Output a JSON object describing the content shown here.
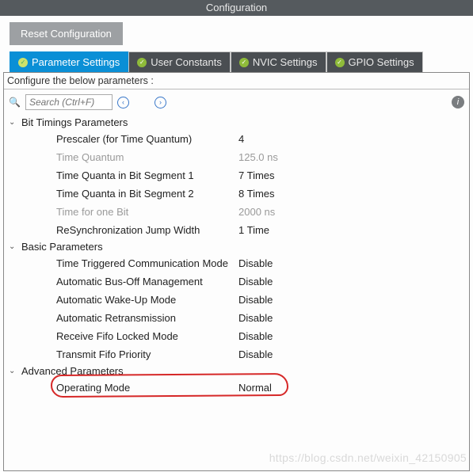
{
  "title": "Configuration",
  "reset_label": "Reset Configuration",
  "tabs": {
    "param": "Parameter Settings",
    "user": "User Constants",
    "nvic": "NVIC Settings",
    "gpio": "GPIO Settings"
  },
  "subheader": "Configure the below parameters :",
  "search_placeholder": "Search (Ctrl+F)",
  "groups": {
    "bit_timings": {
      "label": "Bit Timings Parameters",
      "params": [
        {
          "label": "Prescaler (for Time Quantum)",
          "value": "4",
          "readonly": false
        },
        {
          "label": "Time Quantum",
          "value": "125.0 ns",
          "readonly": true
        },
        {
          "label": "Time Quanta in Bit Segment 1",
          "value": "7 Times",
          "readonly": false
        },
        {
          "label": "Time Quanta in Bit Segment 2",
          "value": "8 Times",
          "readonly": false
        },
        {
          "label": "Time for one Bit",
          "value": "2000 ns",
          "readonly": true
        },
        {
          "label": "ReSynchronization Jump Width",
          "value": "1 Time",
          "readonly": false
        }
      ]
    },
    "basic": {
      "label": "Basic Parameters",
      "params": [
        {
          "label": "Time Triggered Communication Mode",
          "value": "Disable",
          "readonly": false
        },
        {
          "label": "Automatic Bus-Off Management",
          "value": "Disable",
          "readonly": false
        },
        {
          "label": "Automatic Wake-Up Mode",
          "value": "Disable",
          "readonly": false
        },
        {
          "label": "Automatic Retransmission",
          "value": "Disable",
          "readonly": false
        },
        {
          "label": "Receive Fifo Locked Mode",
          "value": "Disable",
          "readonly": false
        },
        {
          "label": "Transmit Fifo Priority",
          "value": "Disable",
          "readonly": false
        }
      ]
    },
    "advanced": {
      "label": "Advanced Parameters",
      "params": [
        {
          "label": "Operating Mode",
          "value": "Normal",
          "readonly": false
        }
      ]
    }
  },
  "watermark": "https://blog.csdn.net/weixin_42150905"
}
